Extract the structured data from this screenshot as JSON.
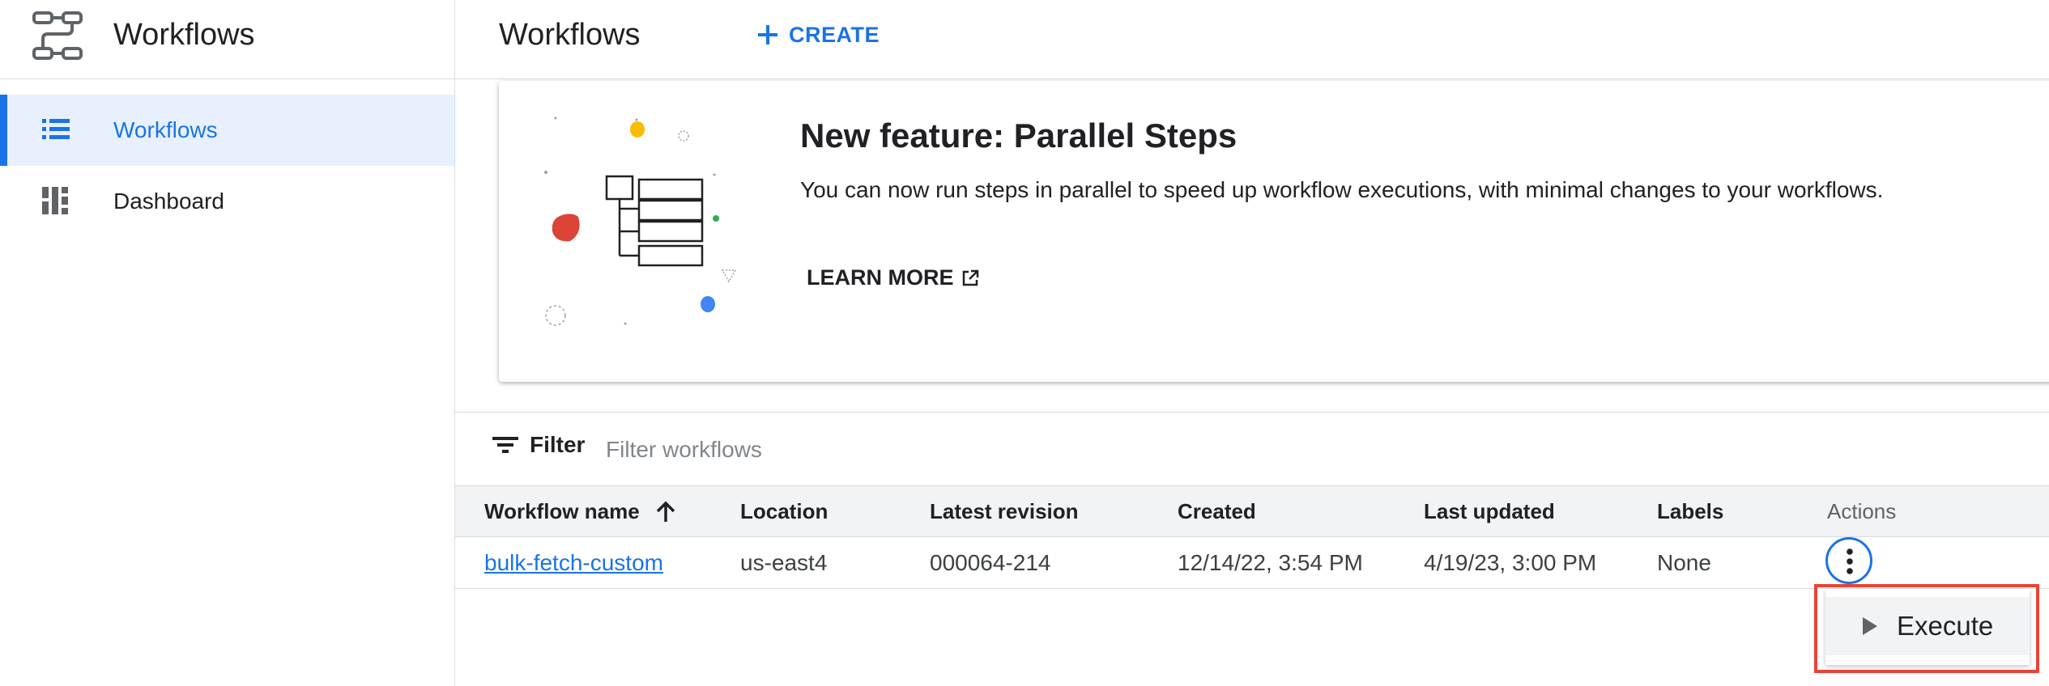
{
  "app": {
    "product_title": "Workflows"
  },
  "sidebar": {
    "items": [
      {
        "label": "Workflows",
        "icon": "list-icon",
        "active": true
      },
      {
        "label": "Dashboard",
        "icon": "dashboard-icon",
        "active": false
      }
    ]
  },
  "header": {
    "title": "Workflows",
    "create_label": "CREATE"
  },
  "banner": {
    "title": "New feature: Parallel Steps",
    "description": "You can now run steps in parallel to speed up workflow executions, with minimal changes to your workflows.",
    "learn_more_label": "LEARN MORE"
  },
  "filter": {
    "label": "Filter",
    "placeholder": "Filter workflows"
  },
  "table": {
    "columns": [
      "Workflow name",
      "Location",
      "Latest revision",
      "Created",
      "Last updated",
      "Labels",
      "Actions"
    ],
    "sort_column": "Workflow name",
    "sort_direction": "ascending",
    "rows": [
      {
        "name": "bulk-fetch-custom",
        "location": "us-east4",
        "latest_revision": "000064-214",
        "created": "12/14/22, 3:54 PM",
        "last_updated": "4/19/23, 3:00 PM",
        "labels": "None"
      }
    ]
  },
  "actions_menu": {
    "items": [
      {
        "label": "Execute",
        "icon": "play-icon"
      }
    ]
  },
  "colors": {
    "accent": "#1a73e8",
    "highlight": "#ea4335",
    "sidebar_active_bg": "#e8f0fe",
    "table_header_bg": "#f1f3f4"
  }
}
